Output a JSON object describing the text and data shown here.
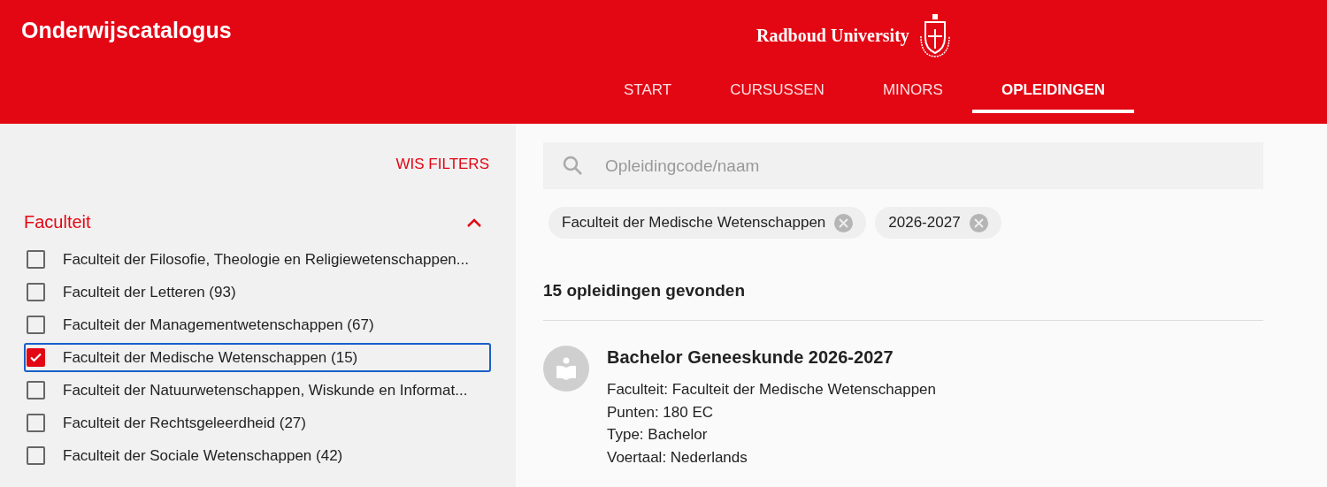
{
  "header": {
    "title": "Onderwijscatalogus",
    "logo_text": "Radboud University"
  },
  "tabs": [
    {
      "label": "START",
      "selected": false
    },
    {
      "label": "CURSUSSEN",
      "selected": false
    },
    {
      "label": "MINORS",
      "selected": false
    },
    {
      "label": "OPLEIDINGEN",
      "selected": true
    }
  ],
  "sidebar": {
    "clear_filters": "WIS FILTERS",
    "section": {
      "title": "Faculteit",
      "expanded": true
    },
    "items": [
      {
        "label": "Faculteit der Filosofie, Theologie en Religiewetenschappen...",
        "checked": false,
        "focused": false
      },
      {
        "label": "Faculteit der Letteren (93)",
        "checked": false,
        "focused": false
      },
      {
        "label": "Faculteit der Managementwetenschappen (67)",
        "checked": false,
        "focused": false
      },
      {
        "label": "Faculteit der Medische Wetenschappen (15)",
        "checked": true,
        "focused": true
      },
      {
        "label": "Faculteit der Natuurwetenschappen, Wiskunde en Informat...",
        "checked": false,
        "focused": false
      },
      {
        "label": "Faculteit der Rechtsgeleerdheid (27)",
        "checked": false,
        "focused": false
      },
      {
        "label": "Faculteit der Sociale Wetenschappen (42)",
        "checked": false,
        "focused": false
      }
    ]
  },
  "search": {
    "placeholder": "Opleidingcode/naam"
  },
  "active_filters": [
    "Faculteit der Medische Wetenschappen",
    "2026-2027"
  ],
  "result_count": "15 opleidingen gevonden",
  "results": [
    {
      "title": "Bachelor Geneeskunde 2026-2027",
      "details": [
        "Faculteit: Faculteit der Medische Wetenschappen",
        "Punten: 180 EC",
        "Type: Bachelor",
        "Voertaal: Nederlands"
      ]
    }
  ]
}
